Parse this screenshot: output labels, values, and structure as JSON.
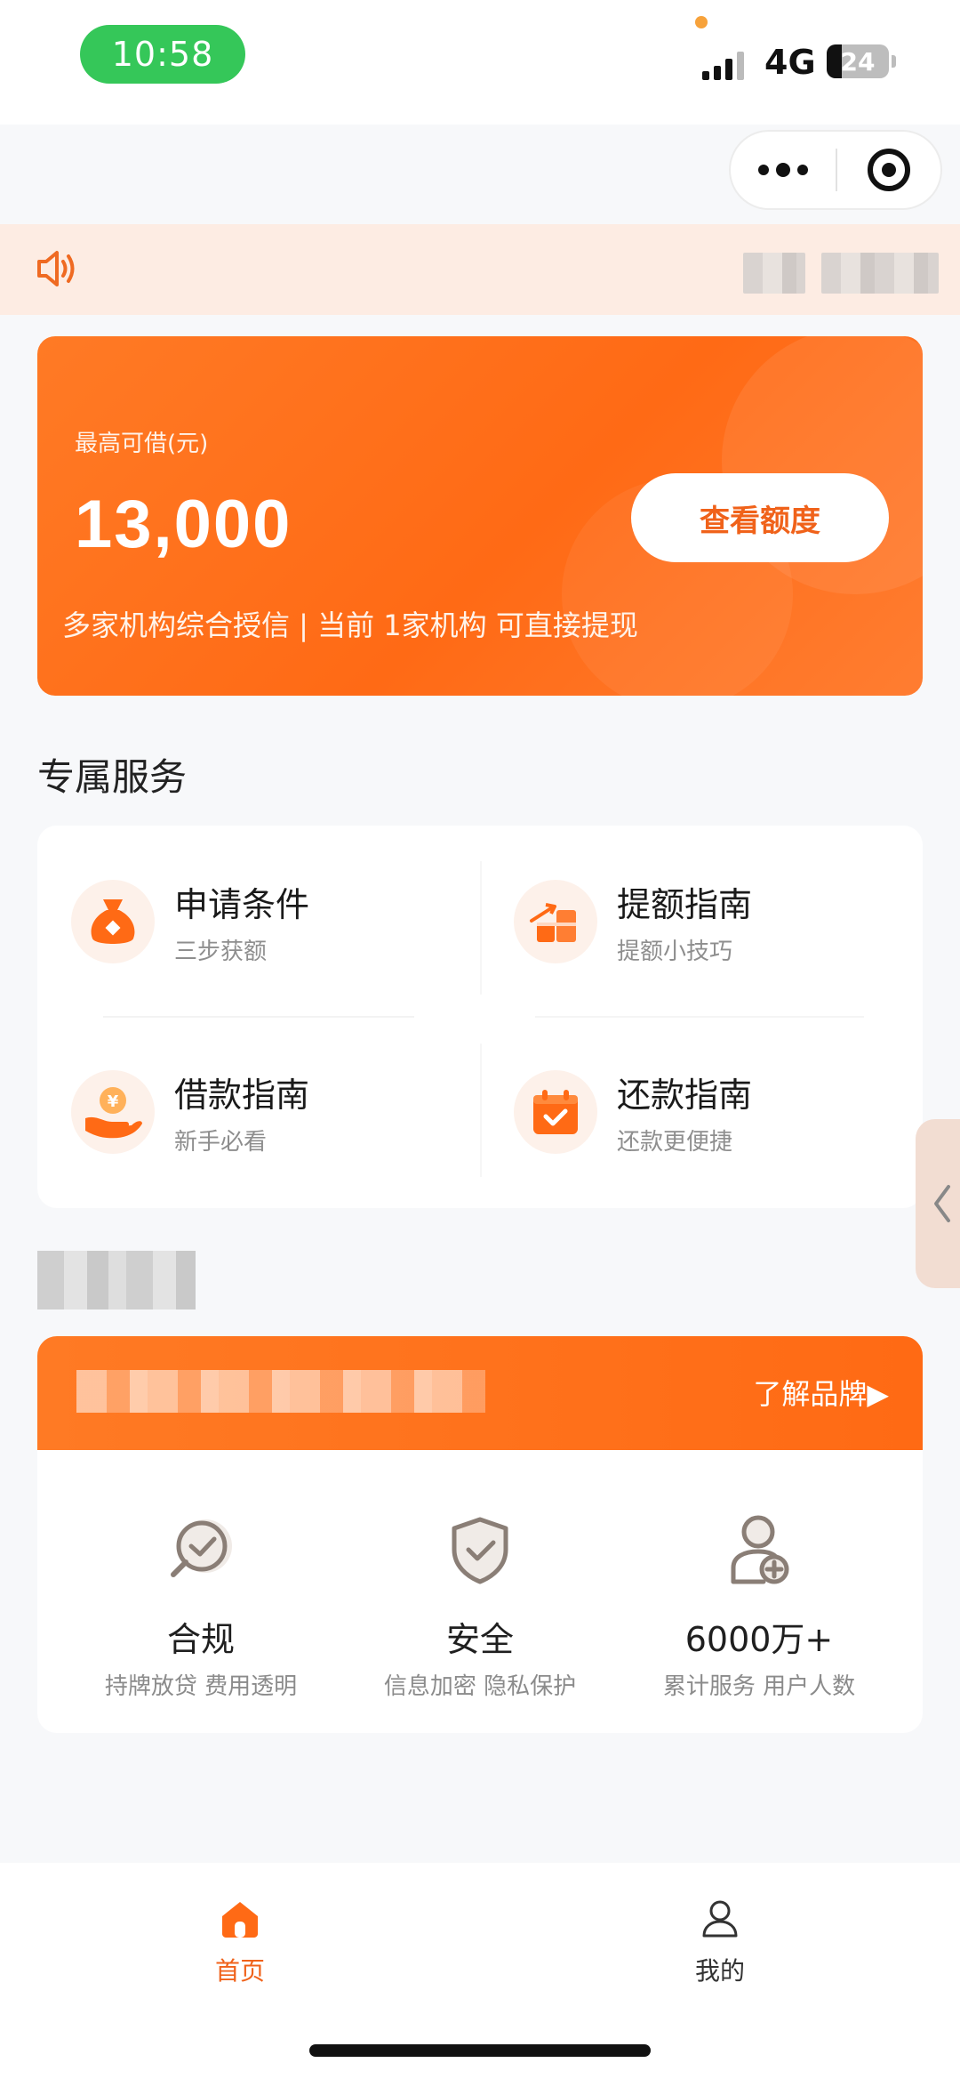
{
  "status_bar": {
    "time": "10:58",
    "network": "4G",
    "battery": "24",
    "battery_level": 0.24
  },
  "capsule": {
    "more_icon": "more-dots-icon",
    "close_icon": "target-close-icon"
  },
  "notice": {
    "icon": "speaker-icon"
  },
  "loan_card": {
    "label": "最高可借(元)",
    "amount": "13,000",
    "button_label": "查看额度",
    "description": "多家机构综合授信 | 当前 1家机构 可直接提现"
  },
  "services": {
    "title": "专属服务",
    "items": [
      {
        "title": "申请条件",
        "subtitle": "三步获额",
        "icon": "money-bag-icon"
      },
      {
        "title": "提额指南",
        "subtitle": "提额小技巧",
        "icon": "growth-chart-icon"
      },
      {
        "title": "借款指南",
        "subtitle": "新手必看",
        "icon": "yuan-coin-hand-icon"
      },
      {
        "title": "还款指南",
        "subtitle": "还款更便捷",
        "icon": "calendar-check-icon"
      }
    ]
  },
  "brand": {
    "link_label": "了解品牌▶",
    "features": [
      {
        "title": "合规",
        "subtitle": "持牌放贷 费用透明",
        "icon": "magnifier-check-icon"
      },
      {
        "title": "安全",
        "subtitle": "信息加密 隐私保护",
        "icon": "shield-check-icon"
      },
      {
        "title": "6000万+",
        "subtitle": "累计服务 用户人数",
        "icon": "user-add-icon"
      }
    ]
  },
  "bottom_nav": {
    "items": [
      {
        "label": "首页",
        "icon": "home-icon",
        "active": true
      },
      {
        "label": "我的",
        "icon": "profile-icon",
        "active": false
      }
    ]
  },
  "colors": {
    "accent": "#ff6a15",
    "active_nav": "#f0621a",
    "inactive_nav": "#333333"
  }
}
